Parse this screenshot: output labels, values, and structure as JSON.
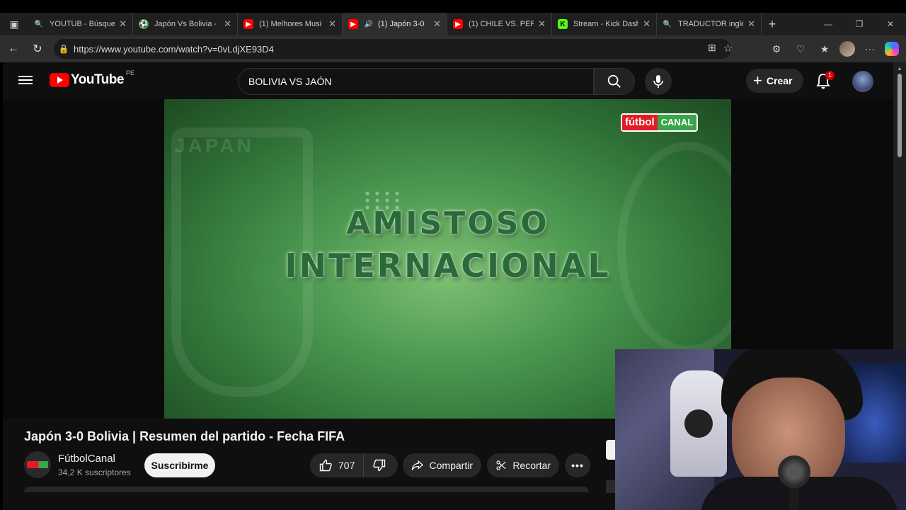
{
  "browser": {
    "tabs": [
      {
        "title": "YOUTUB - Búsque",
        "icon": "search-icon",
        "color": "#4c8bf5",
        "active": false
      },
      {
        "title": "Japón Vs Bolivia -",
        "icon": "soccer-ball-icon",
        "color": "#3aa54a",
        "active": false
      },
      {
        "title": "(1) Melhores Musi",
        "icon": "youtube-icon",
        "color": "#ff0000",
        "active": false
      },
      {
        "title": "(1) Japón 3-0",
        "icon": "youtube-icon",
        "color": "#ff0000",
        "active": true
      },
      {
        "title": "(1) CHILE VS. PERÚ",
        "icon": "youtube-icon",
        "color": "#ff0000",
        "active": false
      },
      {
        "title": "Stream - Kick Dash",
        "icon": "kick-icon",
        "color": "#53fc18",
        "active": false
      },
      {
        "title": "TRADUCTOR inglé",
        "icon": "search-icon",
        "color": "#4c8bf5",
        "active": false
      }
    ],
    "url": "https://www.youtube.com/watch?v=0vLdjXE93D4"
  },
  "youtube": {
    "logo_text": "YouTube",
    "country_code": "PE",
    "search_query": "BOLIVIA VS JAÓN",
    "create_label": "Crear",
    "notification_count": "1",
    "video": {
      "overlay_line1": "AMISTOSO",
      "overlay_line2": "INTERNACIONAL",
      "ghost_text": "JAPAN",
      "bug_part1": "fútbol",
      "bug_part2": "CANAL"
    },
    "title": "Japón 3-0 Bolivia | Resumen del partido - Fecha FIFA",
    "channel": {
      "name": "FútbolCanal",
      "subscribers": "34,2 K suscriptores",
      "subscribe_label": "Suscribirme"
    },
    "actions": {
      "likes": "707",
      "share_label": "Compartir",
      "clip_label": "Recortar"
    }
  }
}
